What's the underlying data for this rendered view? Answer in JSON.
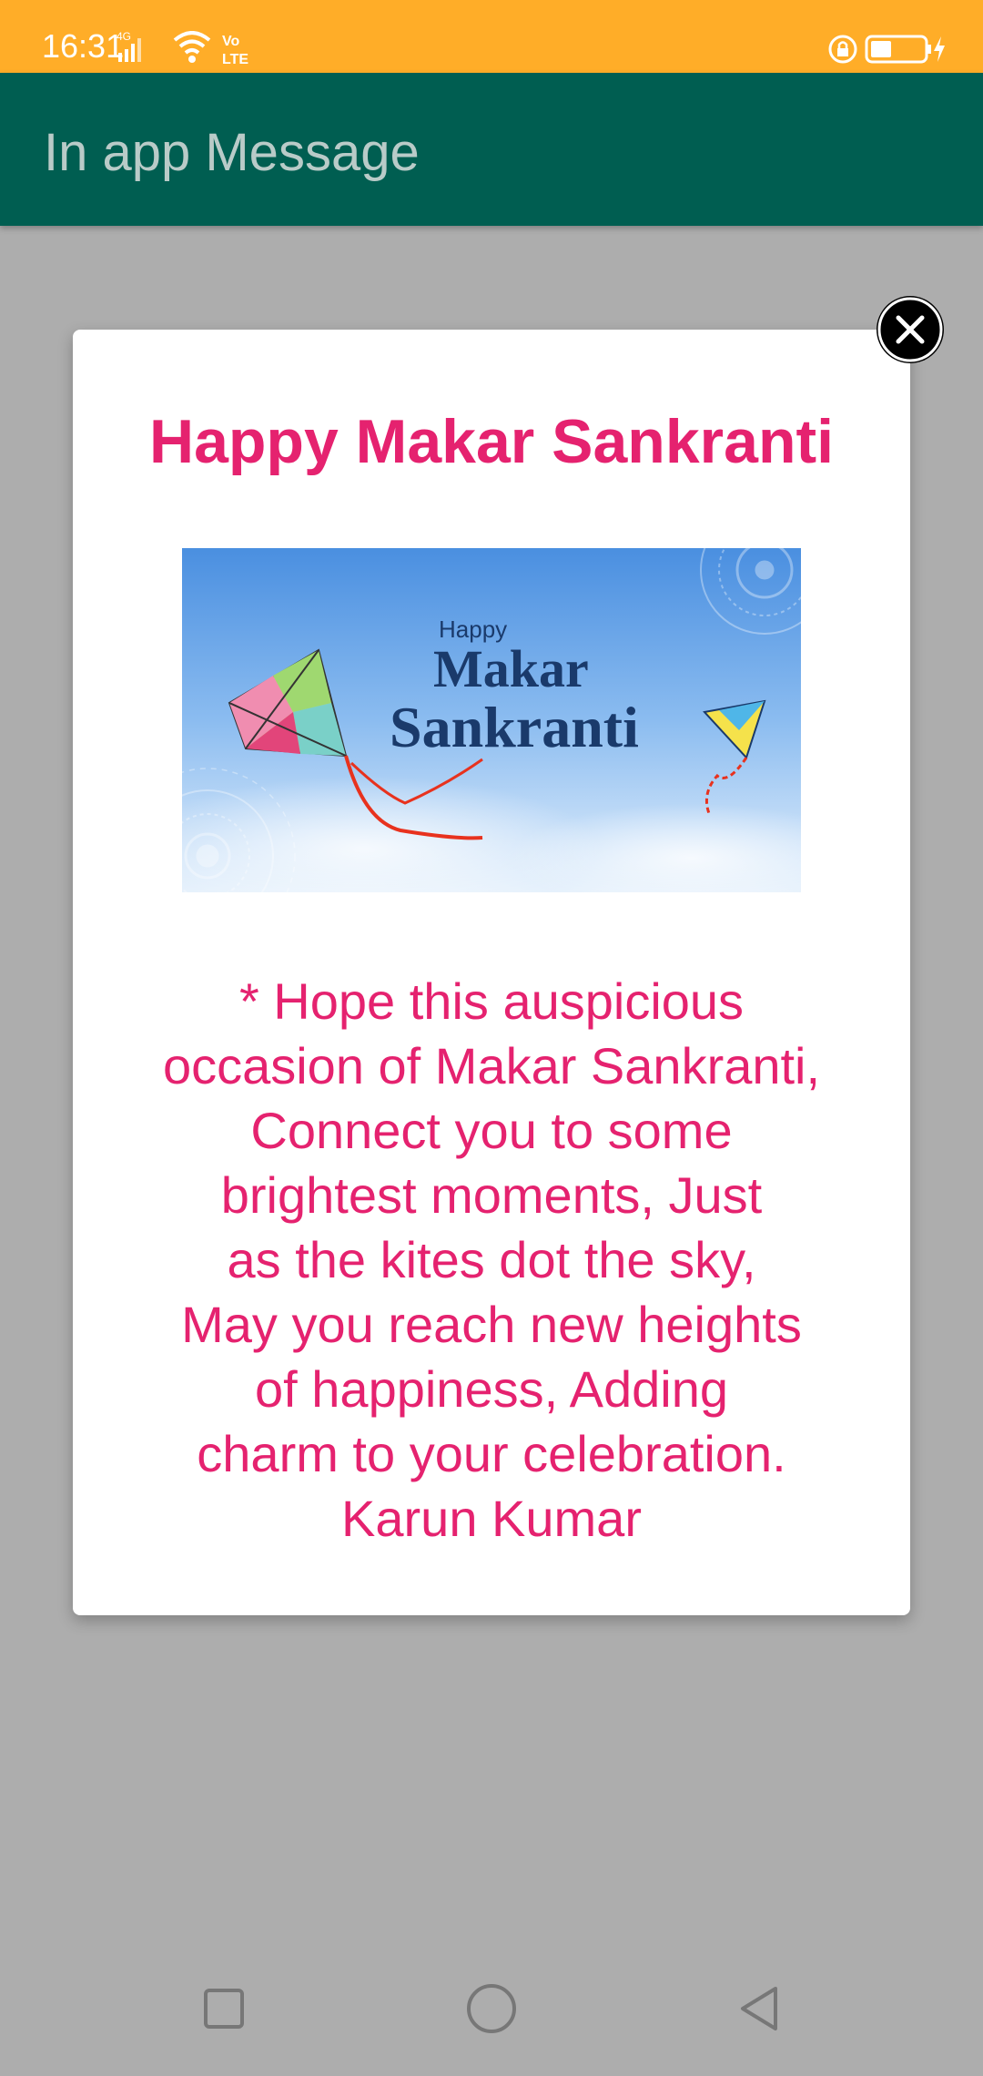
{
  "status_bar": {
    "time": "16:31",
    "network_label": "4G",
    "volte_label": "Vo LTE",
    "icons": [
      "signal-icon",
      "wifi-icon",
      "volte-icon",
      "lock-icon",
      "battery-icon",
      "charging-icon"
    ],
    "color": "#ffad28"
  },
  "app_bar": {
    "title": "In app Message",
    "color": "#005e51"
  },
  "dialog": {
    "title": "Happy Makar Sankranti",
    "banner": {
      "line1": "Happy",
      "line2": "Makar",
      "line3": "Sankranti"
    },
    "message": "* Hope this auspicious\noccasion of Makar Sankranti,\nConnect you to some\nbrightest moments, Just\nas the kites dot the sky,\nMay you reach new heights\nof happiness, Adding\ncharm to your celebration.\nKarun Kumar",
    "accent_color": "#e5226f"
  },
  "close_button": {
    "icon": "close-icon"
  },
  "nav_bar": {
    "buttons": [
      "recents-square-icon",
      "home-circle-icon",
      "back-triangle-icon"
    ]
  }
}
